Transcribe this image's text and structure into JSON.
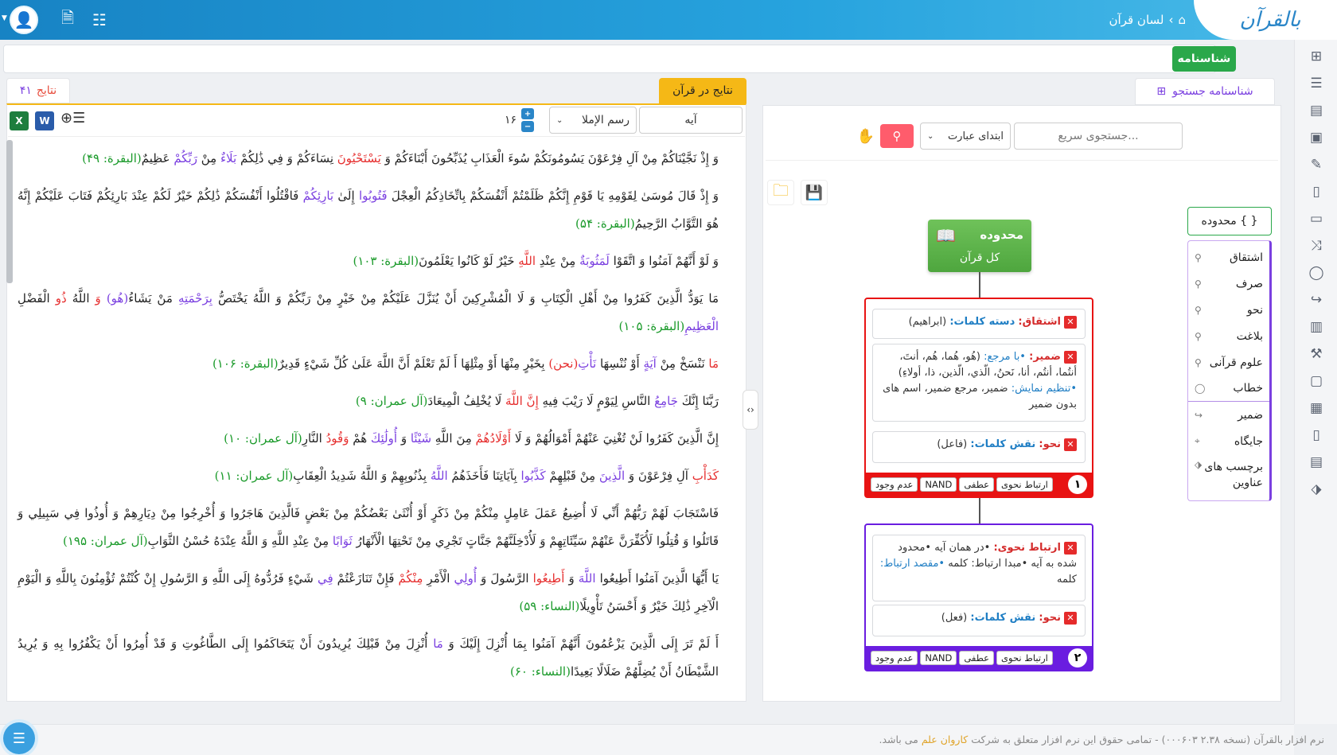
{
  "header": {
    "brand": "بالقرآن",
    "breadcrumb": "لسان قرآن",
    "home_icon": "home-icon"
  },
  "identity": {
    "button_label": "شناسنامه"
  },
  "results": {
    "tab_label": "نتایج در قرآن",
    "count_label": "نتایج",
    "count_value": "۴۱",
    "unit_select": "آیه",
    "script_select": "رسم الإملا",
    "font_size": "۱۶"
  },
  "verses": [
    {
      "segments": [
        {
          "t": "وَ إِذْ نَجَّيْنَاكُمْ مِنْ آلِ فِرْعَوْنَ يَسُومُونَكُمْ سُوءَ الْعَذَابِ يُذَبِّحُونَ أَبْنَاءَكُمْ وَ "
        },
        {
          "t": "يَسْتَحْيُونَ",
          "c": "r"
        },
        {
          "t": " نِسَاءَكُمْ وَ فِي ذَٰلِكُمْ "
        },
        {
          "t": "بَلَاءٌ",
          "c": "p"
        },
        {
          "t": " مِنْ "
        },
        {
          "t": "رَبِّكُمْ",
          "c": "p"
        },
        {
          "t": " عَظِيمٌ"
        },
        {
          "t": "(البقرة: ۴۹)",
          "c": "g"
        }
      ]
    },
    {
      "segments": [
        {
          "t": "وَ إِذْ قَالَ مُوسَىٰ لِقَوْمِهِ يَا قَوْمِ إِنَّكُمْ ظَلَمْتُمْ أَنْفُسَكُمْ بِاتِّخَاذِكُمُ الْعِجْلَ "
        },
        {
          "t": "فَتُوبُوا",
          "c": "p"
        },
        {
          "t": " إِلَىٰ "
        },
        {
          "t": "بَارِئِكُمْ",
          "c": "p"
        },
        {
          "t": " فَاقْتُلُوا أَنْفُسَكُمْ ذَٰلِكُمْ خَيْرٌ لَكُمْ عِنْدَ بَارِئِكُمْ فَتَابَ عَلَيْكُمْ إِنَّهُ هُوَ التَّوَّابُ الرَّحِيمُ"
        },
        {
          "t": "(البقرة: ۵۴)",
          "c": "g"
        }
      ]
    },
    {
      "segments": [
        {
          "t": "وَ لَوْ أَنَّهُمْ آمَنُوا وَ اتَّقَوْا "
        },
        {
          "t": "لَمَثُوبَةٌ",
          "c": "p"
        },
        {
          "t": " مِنْ عِنْدِ "
        },
        {
          "t": "اللَّهِ",
          "c": "r"
        },
        {
          "t": " خَيْرٌ لَوْ كَانُوا يَعْلَمُونَ"
        },
        {
          "t": "(البقرة: ۱۰۳)",
          "c": "g"
        }
      ]
    },
    {
      "segments": [
        {
          "t": "مَا يَوَدُّ الَّذِينَ كَفَرُوا مِنْ أَهْلِ الْكِتَابِ وَ لَا الْمُشْرِكِينَ أَنْ يُنَزَّلَ عَلَيْكُمْ مِنْ خَيْرٍ مِنْ رَبِّكُمْ وَ اللَّهُ يَخْتَصُّ "
        },
        {
          "t": "بِرَحْمَتِهِ",
          "c": "p"
        },
        {
          "t": " مَنْ يَشَاءُ"
        },
        {
          "t": "(هُو)",
          "c": "p"
        },
        {
          "t": " وَ",
          "c": "r"
        },
        {
          "t": " اللَّهُ "
        },
        {
          "t": "ذُو",
          "c": "r"
        },
        {
          "t": " الْفَضْلِ "
        },
        {
          "t": "الْعَظِيمِ",
          "c": "p"
        },
        {
          "t": "(البقرة: ۱۰۵)",
          "c": "g"
        }
      ]
    },
    {
      "segments": [
        {
          "t": "مَا",
          "c": "r"
        },
        {
          "t": " نَنْسَخْ مِنْ "
        },
        {
          "t": "آيَةٍ",
          "c": "p"
        },
        {
          "t": " أَوْ نُنْسِهَا "
        },
        {
          "t": "نَأْتِ",
          "c": "p"
        },
        {
          "t": "(نحن)",
          "c": "r"
        },
        {
          "t": " بِخَيْرٍ مِنْهَا أَوْ مِثْلِهَا أَ لَمْ تَعْلَمْ أَنَّ اللَّهَ عَلَىٰ كُلِّ شَيْءٍ قَدِيرٌ"
        },
        {
          "t": "(البقرة: ۱۰۶)",
          "c": "g"
        }
      ]
    },
    {
      "segments": [
        {
          "t": "رَبَّنَا إِنَّكَ "
        },
        {
          "t": "جَامِعُ",
          "c": "p"
        },
        {
          "t": " النَّاسِ لِيَوْمٍ لَا رَيْبَ فِيهِ "
        },
        {
          "t": "إِنَّ اللَّهَ",
          "c": "r"
        },
        {
          "t": " لَا يُخْلِفُ الْمِيعَادَ"
        },
        {
          "t": "(آل عمران: ۹)",
          "c": "g"
        }
      ]
    },
    {
      "segments": [
        {
          "t": "إِنَّ الَّذِينَ كَفَرُوا لَنْ تُغْنِيَ عَنْهُمْ أَمْوَالُهُمْ وَ لَا "
        },
        {
          "t": "أَوْلَادُهُمْ",
          "c": "r"
        },
        {
          "t": " مِنَ اللَّهِ "
        },
        {
          "t": "شَيْئًا",
          "c": "p"
        },
        {
          "t": " وَ "
        },
        {
          "t": "أُولَٰئِكَ",
          "c": "p"
        },
        {
          "t": " هُمْ "
        },
        {
          "t": "وَقُودُ",
          "c": "r"
        },
        {
          "t": " النَّارِ"
        },
        {
          "t": "(آل عمران: ۱۰)",
          "c": "g"
        }
      ]
    },
    {
      "segments": [
        {
          "t": "كَدَأْبِ",
          "c": "r"
        },
        {
          "t": " آلِ فِرْعَوْنَ وَ "
        },
        {
          "t": "الَّذِينَ",
          "c": "p"
        },
        {
          "t": " مِنْ قَبْلِهِمْ "
        },
        {
          "t": "كَذَّبُوا",
          "c": "p"
        },
        {
          "t": " بِآيَاتِنَا فَأَخَذَهُمُ "
        },
        {
          "t": "اللَّهُ",
          "c": "p"
        },
        {
          "t": " بِذُنُوبِهِمْ وَ اللَّهُ شَدِيدُ الْعِقَابِ"
        },
        {
          "t": "(آل عمران: ۱۱)",
          "c": "g"
        }
      ]
    },
    {
      "segments": [
        {
          "t": "فَاسْتَجَابَ لَهُمْ رَبُّهُمْ أَنِّي لَا أُضِيعُ عَمَلَ عَامِلٍ مِنْكُمْ مِنْ ذَكَرٍ أَوْ أُنْثَىٰ بَعْضُكُمْ مِنْ بَعْضٍ فَالَّذِينَ هَاجَرُوا وَ أُخْرِجُوا مِنْ دِيَارِهِمْ وَ أُوذُوا فِي سَبِيلِي وَ قَاتَلُوا وَ قُتِلُوا لَأُكَفِّرَنَّ عَنْهُمْ سَيِّئَاتِهِمْ وَ لَأُدْخِلَنَّهُمْ جَنَّاتٍ تَجْرِي مِنْ تَحْتِهَا الْأَنْهَارُ "
        },
        {
          "t": "ثَوَابًا",
          "c": "p"
        },
        {
          "t": " مِنْ عِنْدِ اللَّهِ وَ اللَّهُ عِنْدَهُ حُسْنُ الثَّوَابِ"
        },
        {
          "t": "(آل عمران: ۱۹۵)",
          "c": "g"
        }
      ]
    },
    {
      "segments": [
        {
          "t": "يَا أَيُّهَا الَّذِينَ آمَنُوا أَطِيعُوا "
        },
        {
          "t": "اللَّهَ",
          "c": "p"
        },
        {
          "t": " وَ "
        },
        {
          "t": "أَطِيعُوا",
          "c": "r"
        },
        {
          "t": " الرَّسُولَ وَ "
        },
        {
          "t": "أُولِي",
          "c": "p"
        },
        {
          "t": " الْأَمْرِ "
        },
        {
          "t": "مِنْكُمْ",
          "c": "r"
        },
        {
          "t": " فَإِنْ تَنَازَعْتُمْ "
        },
        {
          "t": "فِي",
          "c": "p"
        },
        {
          "t": " شَيْءٍ فَرُدُّوهُ إِلَى اللَّهِ وَ الرَّسُولِ إِنْ كُنْتُمْ تُؤْمِنُونَ بِاللَّهِ وَ الْيَوْمِ الْآخِرِ ذَٰلِكَ خَيْرٌ وَ أَحْسَنُ تَأْوِيلًا"
        },
        {
          "t": "(النساء: ۵۹)",
          "c": "g"
        }
      ]
    },
    {
      "segments": [
        {
          "t": "أَ لَمْ تَرَ إِلَى الَّذِينَ يَزْعُمُونَ أَنَّهُمْ آمَنُوا بِمَا أُنْزِلَ إِلَيْكَ وَ "
        },
        {
          "t": "مَا",
          "c": "p"
        },
        {
          "t": " أُنْزِلَ مِنْ قَبْلِكَ يُرِيدُونَ أَنْ يَتَحَاكَمُوا إِلَى الطَّاغُوتِ وَ قَدْ أُمِرُوا أَنْ يَكْفُرُوا بِهِ وَ يُرِيدُ الشَّيْطَانُ أَنْ يُضِلَّهُمْ ضَلَالًا بَعِيدًا"
        },
        {
          "t": "(النساء: ۶۰)",
          "c": "g"
        }
      ]
    }
  ],
  "search": {
    "profile_tab": "شناسنامه جستجو",
    "quick_placeholder": "جستجوی سریع...",
    "match_select": "ابتدای عبارت"
  },
  "scope_node": {
    "title": "محدوده",
    "subtitle": "کل قرآن"
  },
  "groups": [
    {
      "number": "۱",
      "color": "#e81313",
      "conditions": [
        {
          "label": "اشتقاق:",
          "sub_label": "دسته کلمات:",
          "value": "(ابراهیم)"
        },
        {
          "label": "ضمیر:",
          "sub_label": "•با مرجع:",
          "value": "(هُو، هُما، هُم، أنتَ، أنتُما، أنتُم، أنا، نَحنُ، الّذي، الّذين، ذا، أولاءِ)",
          "extra_label": "•تنظیم نمایش:",
          "extra_value": "ضمیر، مرجع ضمیر، اسم های بدون ضمیر"
        },
        {
          "label": "نحو:",
          "sub_label": "نقش کلمات:",
          "value": "(فاعل)"
        }
      ],
      "buttons": [
        "ارتباط نحوی",
        "عطفی",
        "NAND",
        "عدم وجود"
      ]
    },
    {
      "number": "۲",
      "color": "#6a1de0",
      "conditions": [
        {
          "label": "ارتباط نحوی:",
          "sub_label": "•در همان آیه •محدود شده به آیه •مبدا ارتباط:",
          "value": "کلمه",
          "extra_label": "•مقصد ارتباط:",
          "extra_value": "کلمه"
        },
        {
          "label": "نحو:",
          "sub_label": "نقش کلمات:",
          "value": "(فعل)"
        }
      ],
      "buttons": [
        "ارتباط نحوی",
        "عطفی",
        "NAND",
        "عدم وجود"
      ]
    }
  ],
  "condition_menu": {
    "scope_button": "{ } محدوده",
    "items": [
      "اشتقاق",
      "صرف",
      "نحو",
      "بلاغت",
      "علوم قرآنی",
      "خطاب",
      "ضمیر",
      "جایگاه",
      "برچسب های عناوین"
    ]
  },
  "footer": {
    "prefix": "نرم افزار بالقرآن (نسخه ۲.۳۸ ۰۰۰۶۰۳) - تمامی حقوق این نرم افزار متعلق به شرکت",
    "company": "کاروان علم",
    "suffix": "می باشد."
  },
  "colors": {
    "header": "#1f8fd0",
    "accent_green": "#2aa84a",
    "accent_orange": "#f5b816",
    "group1": "#e81313",
    "group2": "#6a1de0"
  }
}
